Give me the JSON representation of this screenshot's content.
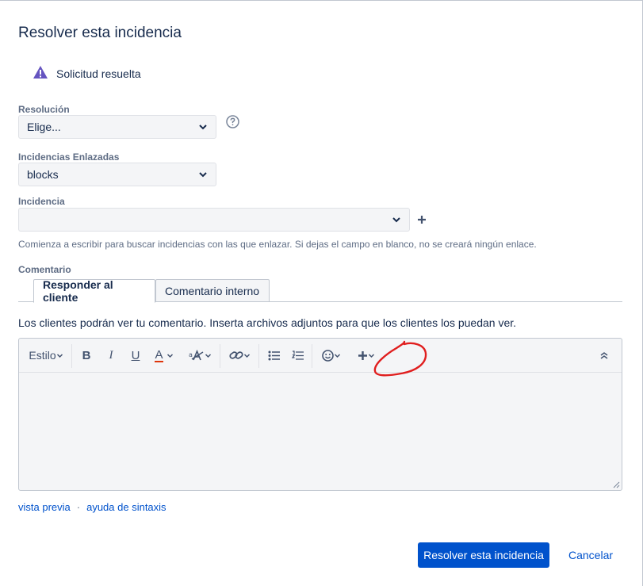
{
  "dialog": {
    "title": "Resolver esta incidencia"
  },
  "status": {
    "text": "Solicitud resuelta",
    "icon": "warning-triangle-icon",
    "icon_color": "#6554c0"
  },
  "resolution": {
    "label": "Resolución",
    "value": "Elige..."
  },
  "linked_issues": {
    "label": "Incidencias Enlazadas",
    "value": "blocks"
  },
  "issue": {
    "label": "Incidencia",
    "value": "",
    "hint": "Comienza a escribir para buscar incidencias con las que enlazar. Si dejas el campo en blanco, no se creará ningún enlace."
  },
  "comment": {
    "label": "Comentario",
    "tabs": [
      {
        "label": "Responder al cliente"
      },
      {
        "label": "Comentario interno"
      }
    ],
    "note": "Los clientes podrán ver tu comentario. Inserta archivos adjuntos para que los clientes los puedan ver.",
    "toolbar": {
      "style_label": "Estilo",
      "bold": "B",
      "italic": "I",
      "underline": "U",
      "color": "A"
    }
  },
  "links": {
    "preview": "vista previa",
    "separator": "·",
    "syntax_help": "ayuda de sintaxis"
  },
  "actions": {
    "submit": "Resolver esta incidencia",
    "cancel": "Cancelar"
  },
  "colors": {
    "primary": "#0052cc",
    "annotation": "#e01e1e",
    "text_color_underline": "#de350b"
  }
}
